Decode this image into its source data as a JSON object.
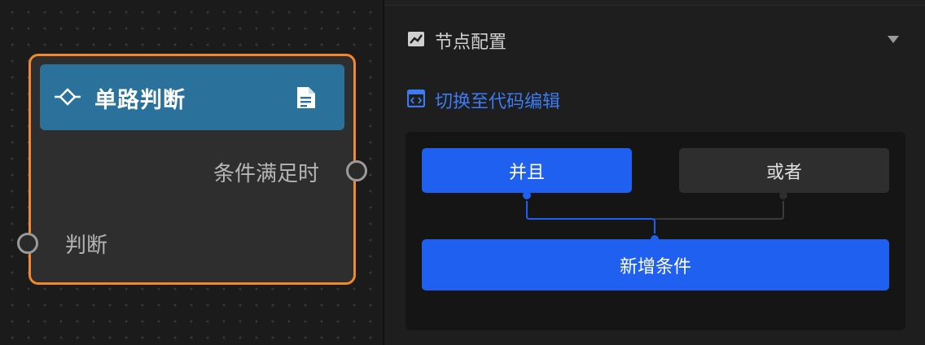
{
  "node": {
    "title": "单路判断",
    "output_label": "条件满足时",
    "input_label": "判断",
    "colors": {
      "border": "#f0892d",
      "header": "#2a719b"
    }
  },
  "panel": {
    "section_title": "节点配置",
    "switch_code_label": "切换至代码编辑",
    "and_label": "并且",
    "or_label": "或者",
    "add_condition_label": "新增条件",
    "colors": {
      "accent": "#2060f0",
      "link": "#3d7bf2"
    }
  },
  "icons": {
    "node": "diamond-icon",
    "doc": "document-icon",
    "section": "chart-icon",
    "collapse": "caret-down-icon",
    "code": "code-icon"
  }
}
